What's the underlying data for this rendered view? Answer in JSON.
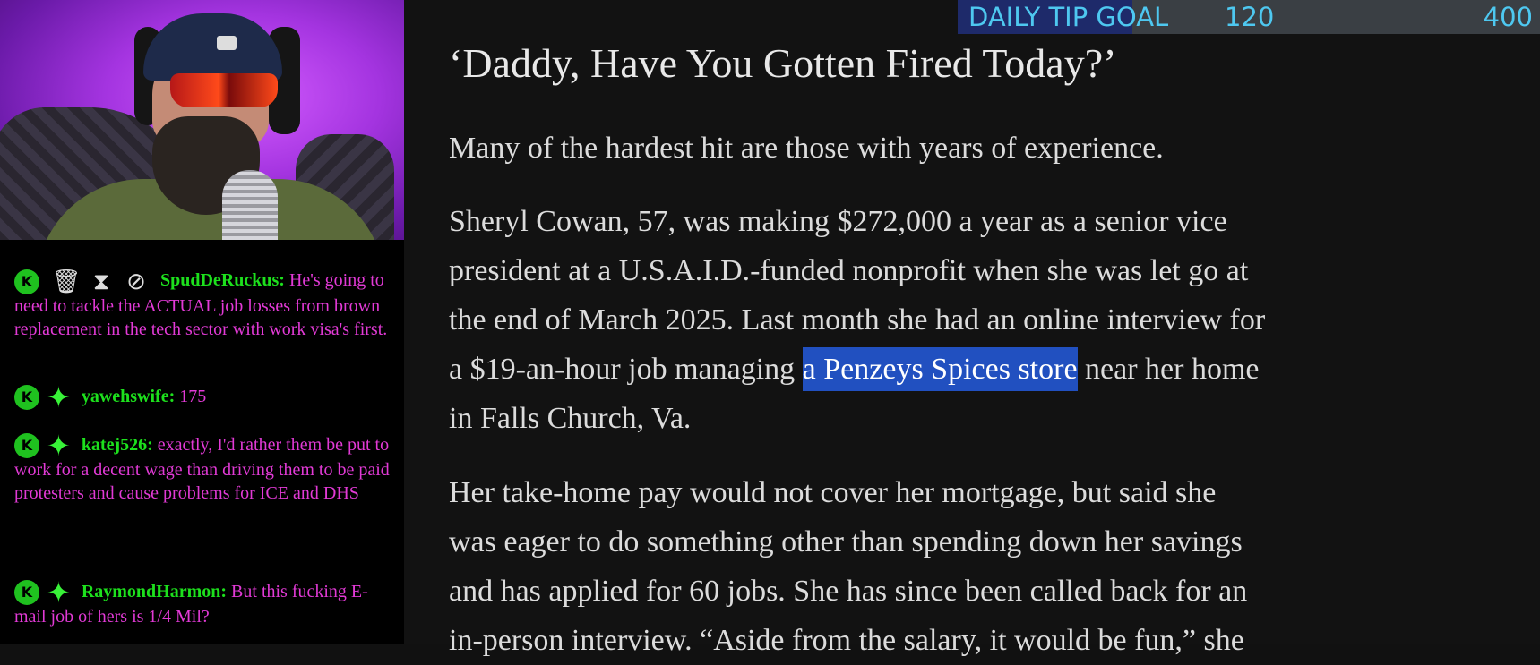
{
  "tip_goal": {
    "label": "DAILY TIP GOAL",
    "current": "120",
    "goal": "400",
    "progress_fraction": 0.3,
    "colors": {
      "text": "#4ec8f0",
      "fill": "#1e2a6a",
      "track": "#3a3f44"
    }
  },
  "chat": {
    "messages": [
      {
        "user": "SpudDeRuckus:",
        "text": "He's going to need to tackle the ACTUAL job losses from brown replacement in the tech sector with work visa's first.",
        "badges": [
          "kick-badge-icon",
          "trash-icon",
          "hourglass-icon",
          "ban-icon"
        ]
      },
      {
        "user": "yawehswife:",
        "text": "175",
        "badges": [
          "kick-badge-icon",
          "sparkle-icon"
        ]
      },
      {
        "user": "katej526:",
        "text": "exactly, I'd rather them be put to work for a decent wage than driving them to be paid protesters and cause problems for ICE and DHS",
        "badges": [
          "kick-badge-icon",
          "sparkle-icon"
        ]
      },
      {
        "user": "RaymondHarmon:",
        "text": "But this fucking E-mail job of hers is 1/4 Mil?",
        "badges": [
          "kick-badge-icon",
          "sparkle-icon"
        ]
      }
    ],
    "colors": {
      "username": "#1de01d",
      "text": "#e23ad6"
    }
  },
  "article": {
    "title": "‘Daddy, Have You Gotten Fired Today?’",
    "subtitle": "Many of the hardest hit are those with years of experience.",
    "para1_line1": "Sheryl Cowan, 57, was making $272,000 a year as a senior vice",
    "para1_line2": "president at a U.S.A.I.D.-funded nonprofit when she was let go at",
    "para1_line3": "the end of March 2025. Last month she had an online interview for",
    "para1_line4_pre": "a $19-an-hour job managing ",
    "para1_highlight": "a Penzeys Spices store",
    "para1_line4_post": " near her home",
    "para1_line5": "in Falls Church, Va.",
    "para2_line1": "Her take-home pay would not cover her mortgage, but said she",
    "para2_line2": "was eager to do something other than spending down her savings",
    "para2_line3": "and has applied for 60 jobs. She has since been called back for an",
    "para2_line4": "in-person interview. “Aside from the salary, it would be fun,” she"
  }
}
